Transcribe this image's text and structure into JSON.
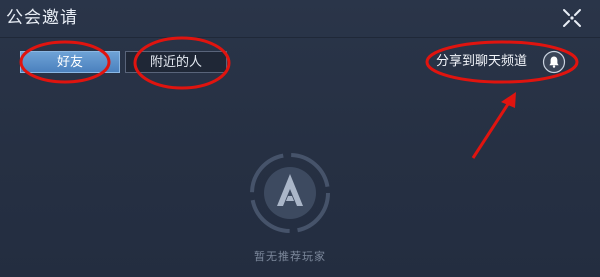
{
  "dialog": {
    "title": "公会邀请",
    "close_icon": "close-icon"
  },
  "tabs": [
    {
      "label": "好友",
      "selected": true
    },
    {
      "label": "附近的人",
      "selected": false
    }
  ],
  "share": {
    "label": "分享到聊天频道",
    "icon": "bell-icon"
  },
  "empty_state": {
    "icon": "guild-emblem-icon",
    "message": "暂无推荐玩家"
  },
  "colors": {
    "background": "#263144",
    "tab_selected": "#5a8fc9",
    "annotation": "#e0140f",
    "muted_text": "#7c889b"
  }
}
